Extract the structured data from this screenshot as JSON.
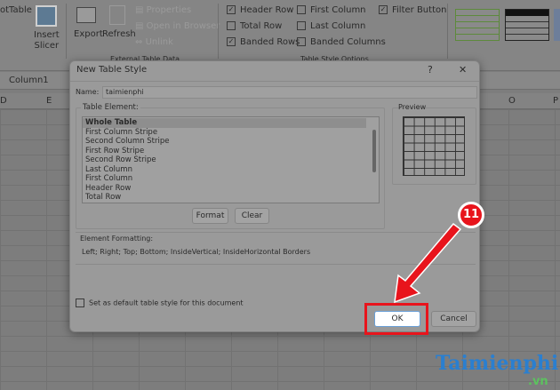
{
  "ribbon": {
    "pivot_label": "otTable",
    "insert_slicer": [
      "Insert",
      "Slicer"
    ],
    "export": "Export",
    "refresh": "Refresh",
    "properties": "Properties",
    "open_in_browser": "Open in Browser",
    "unlink": "Unlink",
    "external_group": "External Table Data",
    "options": [
      {
        "label": "Header Row",
        "checked": true
      },
      {
        "label": "Total Row",
        "checked": false
      },
      {
        "label": "Banded Rows",
        "checked": true
      },
      {
        "label": "First Column",
        "checked": false
      },
      {
        "label": "Last Column",
        "checked": false
      },
      {
        "label": "Banded Columns",
        "checked": false
      },
      {
        "label": "Filter Button",
        "checked": true
      }
    ],
    "options_group": "Table Style Options"
  },
  "formula_bar": {
    "name_box": "Column1"
  },
  "columns": [
    "D",
    "E",
    "O",
    "P"
  ],
  "dialog": {
    "title": "New Table Style",
    "help": "?",
    "close": "✕",
    "name_label": "Name:",
    "name_value": "taimienphi",
    "table_element_label": "Table Element:",
    "elements": [
      "Whole Table",
      "First Column Stripe",
      "Second Column Stripe",
      "First Row Stripe",
      "Second Row Stripe",
      "Last Column",
      "First Column",
      "Header Row",
      "Total Row"
    ],
    "format": "Format",
    "clear": "Clear",
    "preview_label": "Preview",
    "element_formatting_label": "Element Formatting:",
    "element_formatting_value": "Left; Right; Top; Bottom; InsideVertical; InsideHorizontal Borders",
    "default_checkbox": "Set as default table style for this document",
    "ok": "OK",
    "cancel": "Cancel"
  },
  "annotation": {
    "step": "11",
    "color": "#e8141c"
  },
  "watermark": {
    "text": "Taimienphi",
    "suffix": ".vn"
  }
}
